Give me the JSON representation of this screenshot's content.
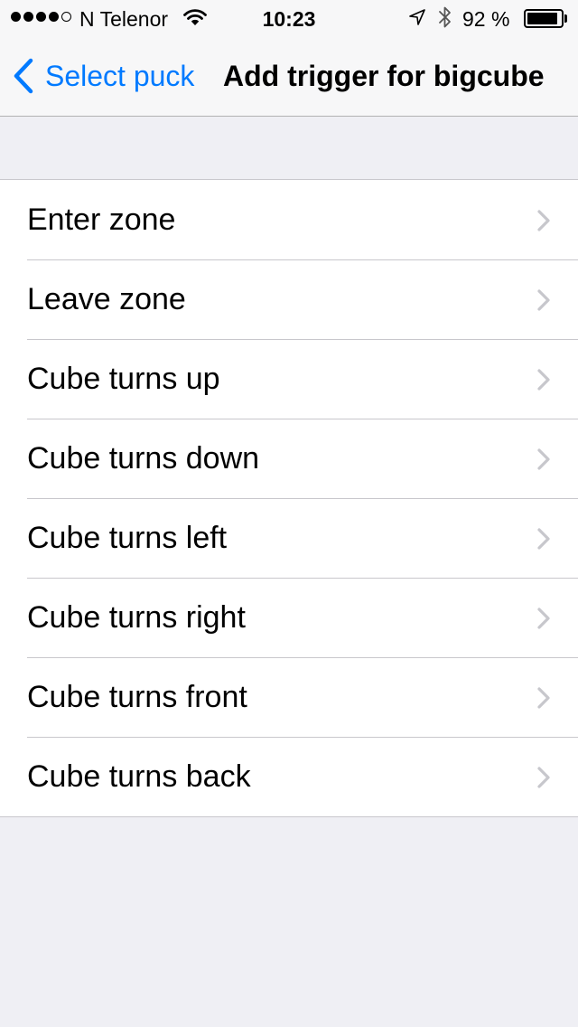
{
  "status_bar": {
    "signal_bars": [
      true,
      true,
      true,
      true,
      false
    ],
    "carrier": "N Telenor",
    "time": "10:23",
    "battery_text": "92 %",
    "battery_level": 0.92
  },
  "nav": {
    "back_label": "Select puck",
    "title": "Add trigger for bigcube",
    "accent_color": "#007aff"
  },
  "triggers": [
    {
      "label": "Enter zone"
    },
    {
      "label": "Leave zone"
    },
    {
      "label": "Cube turns up"
    },
    {
      "label": "Cube turns down"
    },
    {
      "label": "Cube turns left"
    },
    {
      "label": "Cube turns right"
    },
    {
      "label": "Cube turns front"
    },
    {
      "label": "Cube turns back"
    }
  ],
  "icons": {
    "row_accessory": "chevron-right-icon",
    "back": "chevron-left-icon"
  }
}
